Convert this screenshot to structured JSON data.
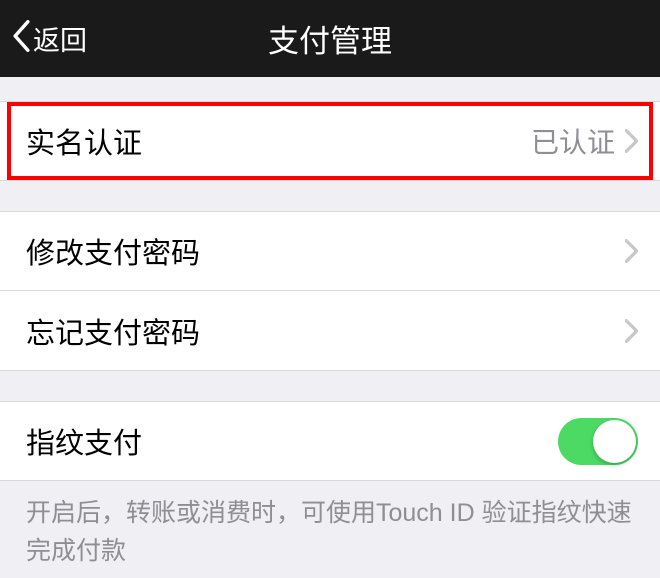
{
  "navbar": {
    "back_label": "返回",
    "title": "支付管理"
  },
  "groups": {
    "identity": {
      "label": "实名认证",
      "value": "已认证"
    },
    "password_change": {
      "label": "修改支付密码"
    },
    "password_forgot": {
      "label": "忘记支付密码"
    },
    "fingerprint": {
      "label": "指纹支付",
      "enabled": true,
      "note": "开启后，转账或消费时，可使用Touch ID 验证指纹快速完成付款"
    }
  }
}
